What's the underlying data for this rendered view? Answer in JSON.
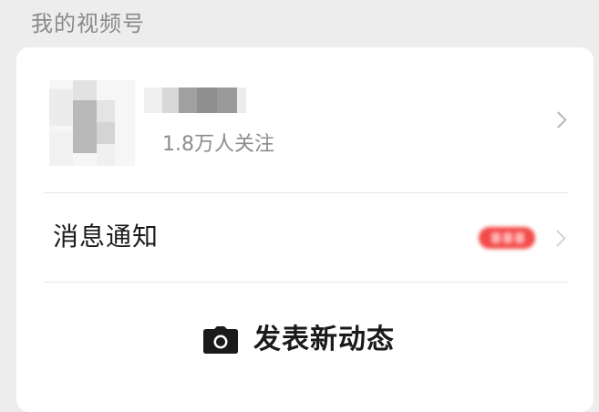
{
  "section": {
    "title": "我的视频号"
  },
  "profile": {
    "followers_text": "1.8万人关注",
    "avatar_icon": "avatar-mosaic",
    "arrow_icon": "chevron-right-icon"
  },
  "messages": {
    "label": "消息通知",
    "badge_color": "#f24a4a",
    "arrow_icon": "chevron-right-icon"
  },
  "publish": {
    "label": "发表新动态",
    "icon": "camera-icon"
  }
}
